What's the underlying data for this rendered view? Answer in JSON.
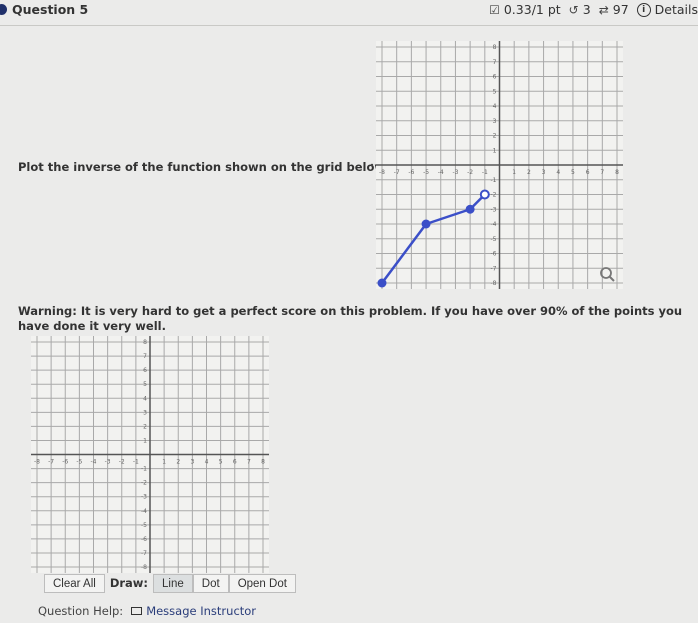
{
  "header": {
    "question_title": "Question 5",
    "score": "0.33/1 pt",
    "retries": "3",
    "attempts": "97",
    "details_label": "Details",
    "icons": {
      "score": "checkbox-icon",
      "retry": "undo-icon",
      "attempts": "repeat-icon",
      "details": "info-icon"
    }
  },
  "prompt": "Plot the inverse of the function shown on the grid below.",
  "warning": "Warning: It is very hard to get a perfect score on this problem. If you have over 90% of the points you have done it very well.",
  "given_graph": {
    "x_range": [
      -8,
      8
    ],
    "y_range": [
      -8,
      8
    ],
    "x_ticks": [
      "-8",
      "-7",
      "-6",
      "-5",
      "-4",
      "-3",
      "-2",
      "-1",
      "1",
      "2",
      "3",
      "4",
      "5",
      "6",
      "7",
      "8"
    ],
    "y_ticks": [
      "8",
      "7",
      "6",
      "5",
      "4",
      "3",
      "2",
      "1",
      "-1",
      "-2",
      "-3",
      "-4",
      "-5",
      "-6",
      "-7",
      "-8"
    ],
    "segments": [
      [
        [
          -8,
          -8
        ],
        [
          -5,
          -4
        ]
      ],
      [
        [
          -5,
          -4
        ],
        [
          -2,
          -3
        ]
      ],
      [
        [
          -2,
          -3
        ],
        [
          -1,
          -2
        ]
      ]
    ],
    "filled_points": [
      [
        -8,
        -8
      ],
      [
        -5,
        -4
      ],
      [
        -2,
        -3
      ]
    ],
    "open_points": [
      [
        -1,
        -2
      ]
    ],
    "line_color": "#3b4fc8",
    "zoom_icon": "magnifier-icon"
  },
  "answer_graph": {
    "x_range": [
      -8,
      8
    ],
    "y_range": [
      -8,
      8
    ],
    "x_ticks": [
      "-8",
      "-7",
      "-6",
      "-5",
      "-4",
      "-3",
      "-2",
      "-1",
      "1",
      "2",
      "3",
      "4",
      "5",
      "6",
      "7",
      "8"
    ],
    "y_ticks": [
      "8",
      "7",
      "6",
      "5",
      "4",
      "3",
      "2",
      "1",
      "-1",
      "-2",
      "-3",
      "-4",
      "-5",
      "-6",
      "-7",
      "-8"
    ]
  },
  "toolbar": {
    "clear_all": "Clear All",
    "draw_label": "Draw:",
    "line": "Line",
    "dot": "Dot",
    "open_dot": "Open Dot",
    "selected": "Line"
  },
  "help": {
    "label": "Question Help:",
    "message_instructor": "Message Instructor"
  }
}
